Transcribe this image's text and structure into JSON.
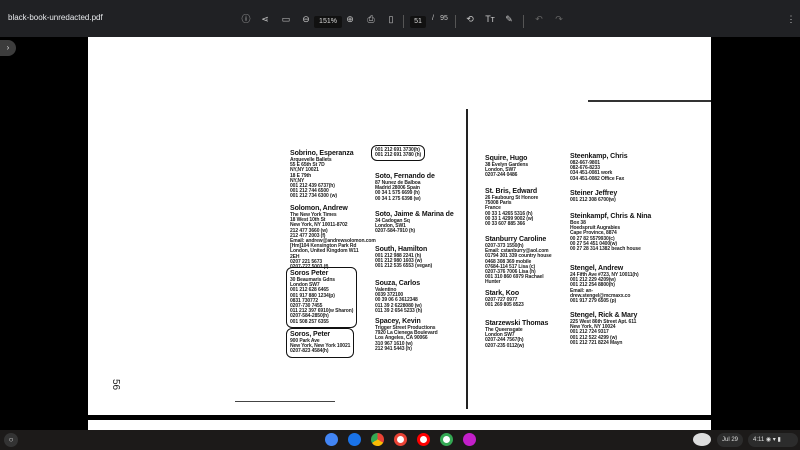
{
  "toolbar": {
    "title": "black-book-unredacted.pdf",
    "zoom": "151%",
    "page_current": "51",
    "page_sep": "/",
    "page_total": "95"
  },
  "document": {
    "page_number": "56",
    "entries": [
      {
        "name": "Sobrino, Esperanza",
        "lines": [
          "Arquevelle Ballets",
          "55 E 65th St 7D",
          "NY,NY 10021",
          "18 E 79th",
          "NY,NY",
          "001 212 439 6737(h)",
          "001 212 744 6500",
          "001 212 734 6300 (w)"
        ],
        "col": 0,
        "row": 150
      },
      {
        "name": "Solomon, Andrew",
        "lines": [
          "The New York Times",
          "18 West 10th St",
          "New York, NY 10011-8702",
          "212 477 3660 (w)",
          "212 477 2003 (f)",
          "Email: andrew@andrewsolomon.com",
          "[Hm]104 Kensington Park Rd",
          "London, United Kingdom W11",
          "2EH",
          "0207 221 5673",
          "0207-727 5003 (f)"
        ],
        "col": 0,
        "row": 205
      },
      {
        "name": "Soros Peter",
        "lines": [
          "30 Beaumaris Gdns",
          "London SW7",
          "001 212 628 6465",
          "001 917 880 1234(p)",
          "0831 730772",
          "0207-730 7455",
          "011 212 397 6910(w Sharon)",
          "0207-584-2850(h)",
          "001 508 257 6355"
        ],
        "col": 0,
        "row": 270,
        "circled": true
      },
      {
        "name": "Soros, Peter",
        "lines": [
          "900 Park Ave",
          "New York, New York 10021",
          "0207-823 4584(h)"
        ],
        "col": 0,
        "row": 331,
        "circled": true
      },
      {
        "name": "",
        "lines": [
          "001 212 691 3730(h)",
          "001 212 691 3780 (h)"
        ],
        "col": 1,
        "row": 148,
        "circled": true
      },
      {
        "name": "Soto, Fernando de",
        "lines": [
          "87 Nunez de Balboa",
          "Madrid 28006 Spain",
          "00 34 1 575 6699 (h)",
          "00 34 1 275 6398 (w)"
        ],
        "col": 1,
        "row": 173
      },
      {
        "name": "Soto, Jaime & Marina de",
        "lines": [
          "34 Cadogan Sq",
          "London, SW1",
          "0207-584-7910 (h)"
        ],
        "col": 1,
        "row": 211
      },
      {
        "name": "South, Hamilton",
        "lines": [
          "001 212 988 2241 (h)",
          "001 212 980 1603 (w)",
          "001 212 535 6553 (vegan)"
        ],
        "col": 1,
        "row": 246
      },
      {
        "name": "Souza, Carlos",
        "lines": [
          "Valentino",
          "0039 372100",
          "00 39 06 6 3612348",
          "011 39 2 6228080 (w)",
          "011 39 2 654 5233 (h)"
        ],
        "col": 1,
        "row": 280
      },
      {
        "name": "Spacey, Kevin",
        "lines": [
          "Trigger Street Productions",
          "7920 La Cienega Boulevard",
          "Los Angeles, CA 90066",
          "310 967 1610 (w)",
          "212 941 5443 (h)"
        ],
        "col": 1,
        "row": 318
      },
      {
        "name": "Squire, Hugo",
        "lines": [
          "38 Evelyn Gardens",
          "London, SW7",
          "0207-244 0486"
        ],
        "col": 2,
        "row": 155
      },
      {
        "name": "St. Bris, Edward",
        "lines": [
          "26 Faubourg St Honore",
          "75008 Paris",
          "France",
          "00 33 1 4265 5316 (h)",
          "00 33 1 4299 9002 (w)",
          "00 33 607 885 366"
        ],
        "col": 2,
        "row": 188
      },
      {
        "name": "Stanburry Caroline",
        "lines": [
          "0207-373 1550(h)",
          "Email: cstanburry@aol.com",
          "01794 301 339 country house",
          "0468 308 369 mobile",
          "07684-114 517 Lisa (c)",
          "0207-376 7006 Lisa (h)",
          "001 310 860 6979 Rachael",
          "Hunter"
        ],
        "col": 2,
        "row": 236
      },
      {
        "name": "Stark, Koo",
        "lines": [
          "0207-727 0977",
          "001 269 805 8523"
        ],
        "col": 2,
        "row": 290
      },
      {
        "name": "Starzewski Thomas",
        "lines": [
          "The Queensgate",
          "London SW7",
          "0207-244 7567(h)",
          "0207-235 0112(w)"
        ],
        "col": 2,
        "row": 320
      },
      {
        "name": "Steenkamp, Chris",
        "lines": [
          "082-667-9801",
          "082-676-8233",
          "034 451-0081 work",
          "034 451-0082 Office Fax"
        ],
        "col": 3,
        "row": 153
      },
      {
        "name": "Steiner Jeffrey",
        "lines": [
          "001 212 308 6700(w)"
        ],
        "col": 3,
        "row": 190
      },
      {
        "name": "Steinkampf, Chris & Nina",
        "lines": [
          "Box 38",
          "Hoedspruit Augrabies",
          "Cape Province, 8874",
          "00 27 82 5579930(c)",
          "00 27 54 451 0400(w)",
          "00 27 28 314 1382 beach house"
        ],
        "col": 3,
        "row": 213
      },
      {
        "name": "Stengel, Andrew",
        "lines": [
          "24 Fifth Ave #723, NY 10011(h)",
          "001 212 229 4209(w)",
          "001 212 254 8800(h)",
          "Email: an-",
          "drew.stengel@mcmaxx.co",
          "001 917 279 6505 (p)"
        ],
        "col": 3,
        "row": 265
      },
      {
        "name": "Stengel, Rick & Mary",
        "lines": [
          "225 West 86th Street Apt. 611",
          "New York, NY 10024",
          "001 212 724 9317",
          "001 212 522 4299 (w)",
          "001 212 721 8224 Mayn"
        ],
        "col": 3,
        "row": 312
      }
    ]
  },
  "taskbar": {
    "date": "Jul 29",
    "time": "4:11"
  }
}
